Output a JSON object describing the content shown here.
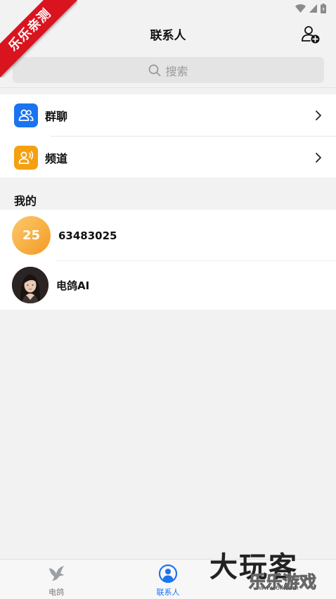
{
  "watermark_ribbon": "乐乐亲测",
  "header": {
    "title": "联系人"
  },
  "search": {
    "placeholder": "搜索"
  },
  "groups": [
    {
      "label": "群聊",
      "color": "#1a73f0",
      "icon": "group-icon"
    },
    {
      "label": "频道",
      "color": "#f5a010",
      "icon": "channel-icon"
    }
  ],
  "section": {
    "title": "我的"
  },
  "contacts": [
    {
      "avatar_text": "25",
      "name": "63483025"
    },
    {
      "avatar_text": "",
      "name": "电鸽AI"
    }
  ],
  "tabbar": {
    "tabs": [
      {
        "label": "电鸽",
        "active": false,
        "icon": "dove-icon"
      },
      {
        "label": "联系人",
        "active": true,
        "icon": "contacts-icon"
      }
    ],
    "active_color": "#1a73f0"
  },
  "watermark_logo": {
    "main": "大玩客",
    "sub": "乐乐游戏",
    "url": "www.6ll.com"
  }
}
